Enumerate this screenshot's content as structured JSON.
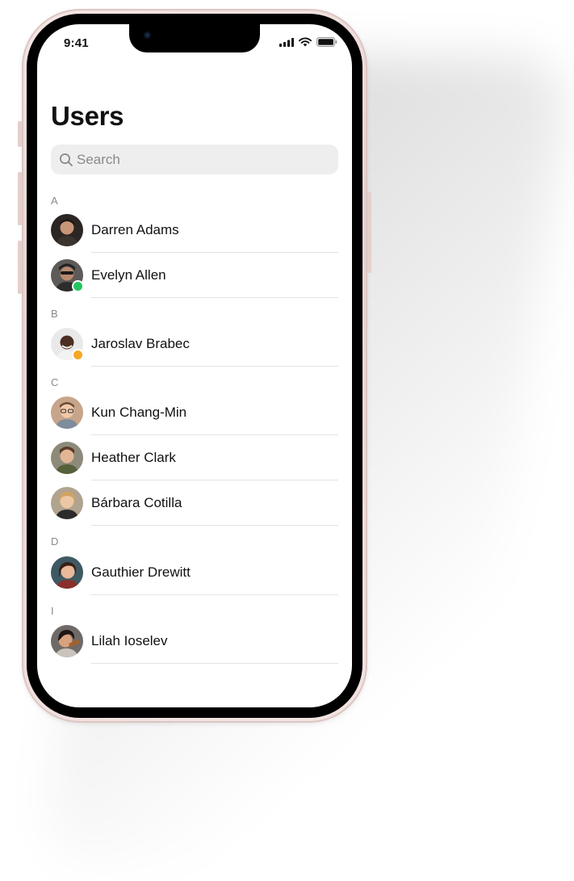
{
  "status_bar": {
    "time": "9:41",
    "icons": [
      "signal-icon",
      "wifi-icon",
      "battery-icon"
    ]
  },
  "page": {
    "title": "Users"
  },
  "search": {
    "placeholder": "Search",
    "icon": "search-icon"
  },
  "sections": [
    {
      "letter": "A",
      "users": [
        {
          "name": "Darren Adams",
          "status": null
        },
        {
          "name": "Evelyn Allen",
          "status": "online"
        }
      ]
    },
    {
      "letter": "B",
      "users": [
        {
          "name": "Jaroslav Brabec",
          "status": "away"
        }
      ]
    },
    {
      "letter": "C",
      "users": [
        {
          "name": "Kun Chang-Min",
          "status": null
        },
        {
          "name": "Heather Clark",
          "status": null
        },
        {
          "name": "Bárbara Cotilla",
          "status": null
        }
      ]
    },
    {
      "letter": "D",
      "users": [
        {
          "name": "Gauthier Drewitt",
          "status": null
        }
      ]
    },
    {
      "letter": "I",
      "users": [
        {
          "name": "Lilah Ioselev",
          "status": null
        }
      ]
    }
  ],
  "colors": {
    "online": "#22c55e",
    "away": "#f5a623",
    "frame": "#efdedc"
  }
}
